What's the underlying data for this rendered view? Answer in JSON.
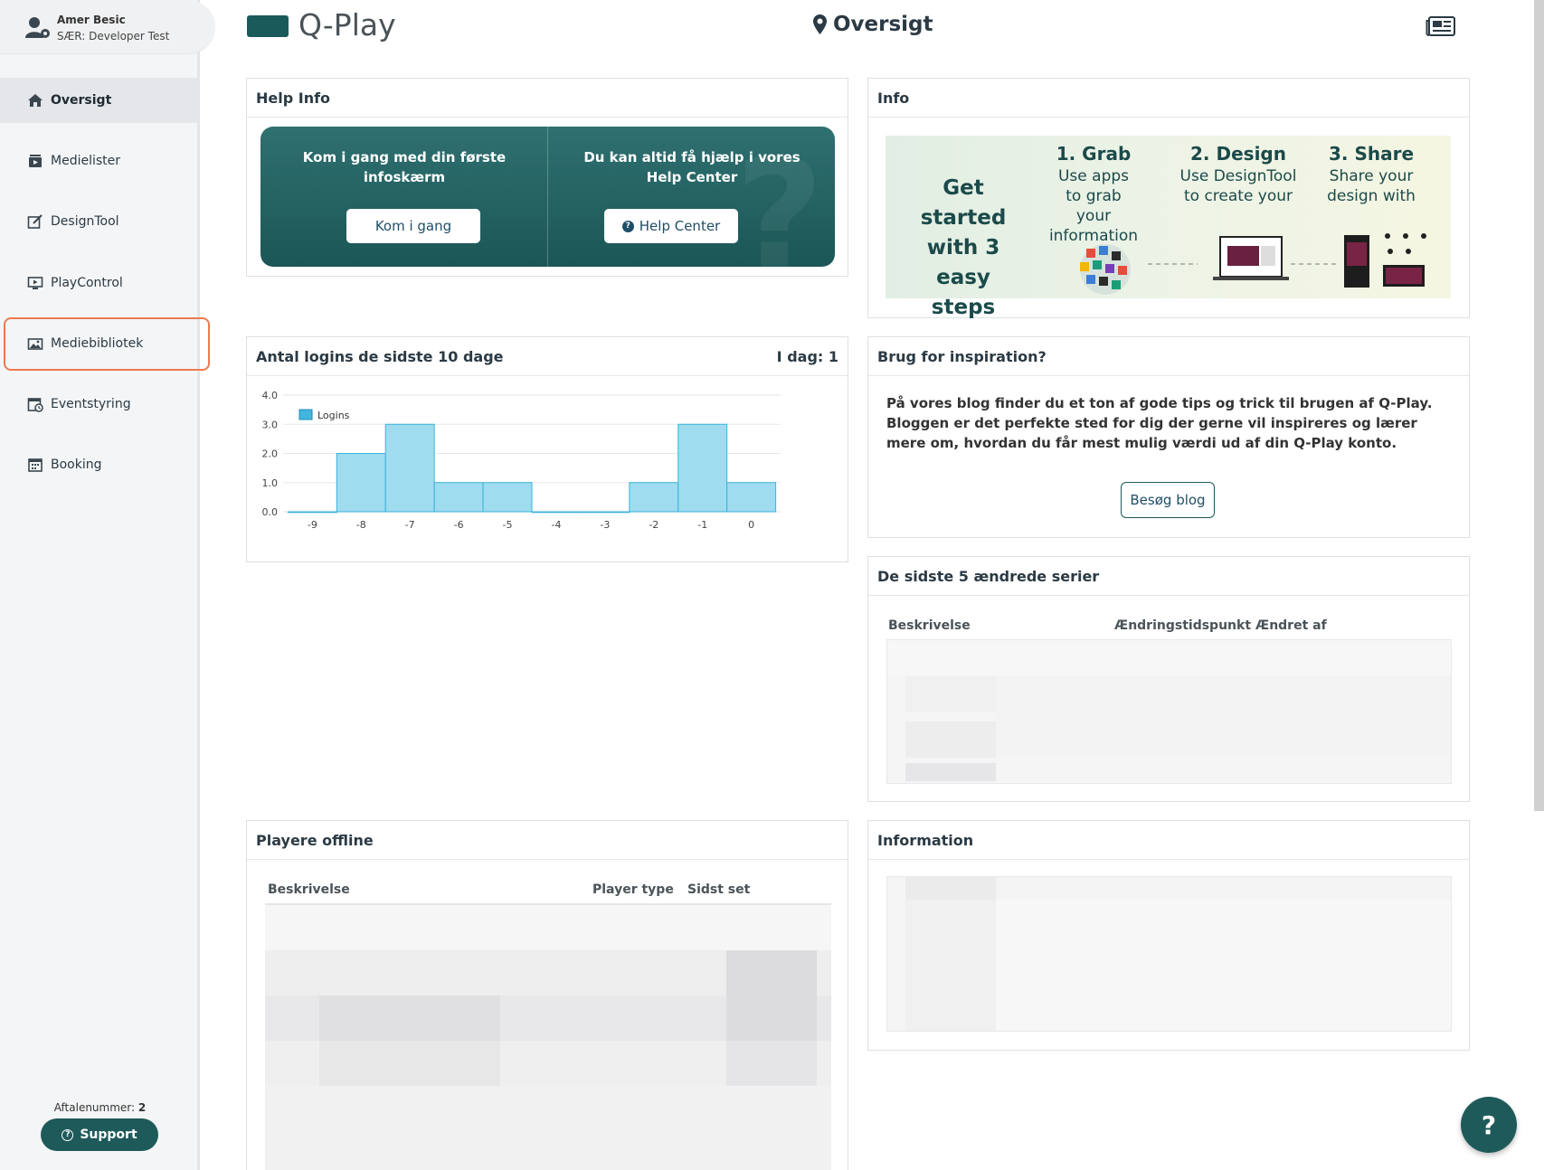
{
  "user": {
    "name": "Amer Besic",
    "org": "SÆR: Developer Test"
  },
  "nav": [
    {
      "label": "Oversigt",
      "icon": "home-icon",
      "active": true
    },
    {
      "label": "Medielister",
      "icon": "media-list-icon",
      "active": false
    },
    {
      "label": "DesignTool",
      "icon": "design-tool-icon",
      "active": false
    },
    {
      "label": "PlayControl",
      "icon": "play-control-icon",
      "active": false
    },
    {
      "label": "Mediebibliotek",
      "icon": "media-library-icon",
      "active": false
    },
    {
      "label": "Eventstyring",
      "icon": "event-calendar-icon",
      "active": false
    },
    {
      "label": "Booking",
      "icon": "booking-calendar-icon",
      "active": false
    }
  ],
  "footer": {
    "agreement_label": "Aftalenummer:",
    "agreement_number": "2",
    "support_label": "Support"
  },
  "header": {
    "logo_text": "Q-Play",
    "page_title": "Oversigt"
  },
  "help_info": {
    "title": "Help Info",
    "left_text": "Kom i gang med din første infoskærm",
    "left_button": "Kom i gang",
    "right_text": "Du kan altid få hjælp i vores Help Center",
    "right_button": "Help Center"
  },
  "info": {
    "title": "Info",
    "banner_title": "Get started with 3 easy steps",
    "steps": [
      {
        "heading": "1. Grab",
        "text": "Use apps to grab your information"
      },
      {
        "heading": "2. Design",
        "text": "Use DesignTool to create your"
      },
      {
        "heading": "3. Share",
        "text": "Share your design with"
      }
    ]
  },
  "logins": {
    "title": "Antal logins de sidste 10 dage",
    "today": "I dag: 1",
    "legend": "Logins"
  },
  "chart_data": {
    "type": "bar",
    "categories": [
      "-9",
      "-8",
      "-7",
      "-6",
      "-5",
      "-4",
      "-3",
      "-2",
      "-1",
      "0"
    ],
    "series": [
      {
        "name": "Logins",
        "values": [
          0,
          2,
          3,
          1,
          1,
          0,
          0,
          1,
          3,
          1
        ]
      }
    ],
    "ylim": [
      0,
      4
    ],
    "yticks": [
      "0.0",
      "1.0",
      "2.0",
      "3.0",
      "4.0"
    ],
    "grid": true,
    "legend_position": "top-left",
    "bar_color": "#9fdcef",
    "bar_stroke": "#3bb3dc"
  },
  "inspiration": {
    "title": "Brug for inspiration?",
    "text": "På vores blog finder du et ton af gode tips og trick til brugen af Q-Play. Bloggen er det perfekte sted for dig der gerne vil inspireres og lærer mere om, hvordan du får mest mulig værdi ud af din Q-Play konto.",
    "button": "Besøg blog"
  },
  "series_changes": {
    "title": "De sidste 5 ændrede serier",
    "columns": [
      "Beskrivelse",
      "Ændringstidspunkt",
      "Ændret af"
    ]
  },
  "players_offline": {
    "title": "Playere offline",
    "columns": [
      "Beskrivelse",
      "Player type",
      "Sidst set"
    ]
  },
  "information": {
    "title": "Information"
  },
  "colors": {
    "brand": "#1f5a5a",
    "highlight": "#ee7a4f",
    "sidebar_bg": "#f4f5f6"
  }
}
